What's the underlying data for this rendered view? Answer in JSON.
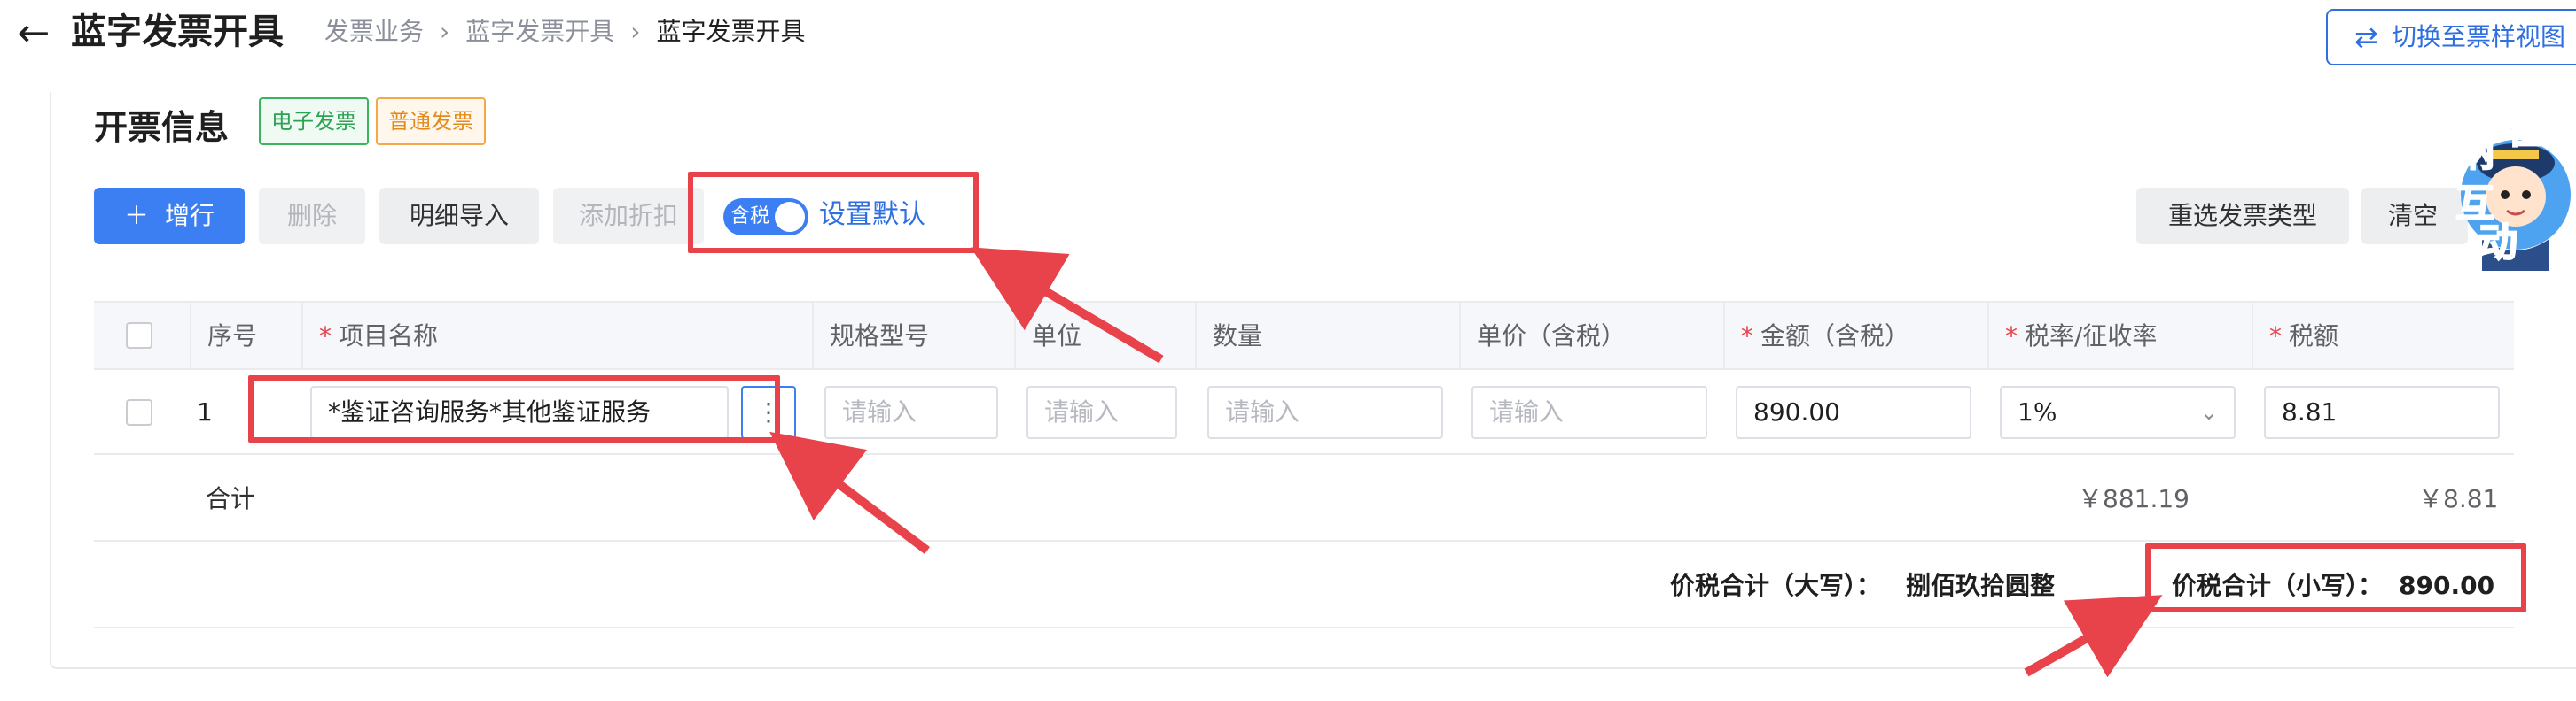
{
  "header": {
    "title": "蓝字发票开具",
    "breadcrumb": [
      "发票业务",
      "蓝字发票开具",
      "蓝字发票开具"
    ],
    "switch_view_label": "切换至票样视图"
  },
  "section": {
    "title": "开票信息",
    "tags": [
      "电子发票",
      "普通发票"
    ]
  },
  "toolbar": {
    "add_row": "增行",
    "delete": "删除",
    "import_details": "明细导入",
    "add_discount": "添加折扣",
    "tax_toggle_label": "含税",
    "set_default": "设置默认",
    "reselect_type": "重选发票类型",
    "clear": "清空"
  },
  "mascot_text": [
    "征",
    "纳",
    "互",
    "动"
  ],
  "table": {
    "headers": {
      "index": "序号",
      "item_name": "项目名称",
      "spec": "规格型号",
      "unit": "单位",
      "quantity": "数量",
      "unit_price": "单价（含税）",
      "amount": "金额（含税）",
      "tax_rate": "税率/征收率",
      "tax": "税额"
    },
    "rows": [
      {
        "index": "1",
        "item_name": "*鉴证咨询服务*其他鉴证服务",
        "spec_placeholder": "请输入",
        "unit_placeholder": "请输入",
        "quantity_placeholder": "请输入",
        "price_placeholder": "请输入",
        "amount": "890.00",
        "tax_rate": "1%",
        "tax": "8.81"
      }
    ],
    "summary": {
      "label": "合计",
      "amount": "￥881.19",
      "tax": "￥8.81"
    },
    "totals": {
      "upper_label": "价税合计（大写）：",
      "upper_value": "捌佰玖拾圆整",
      "lower_label": "价税合计（小写）：",
      "lower_value": "890.00"
    }
  },
  "colors": {
    "primary": "#3b7ff2",
    "annotation_red": "#e8424a",
    "tag_green": "#2aa352",
    "tag_orange": "#e48a1a"
  }
}
